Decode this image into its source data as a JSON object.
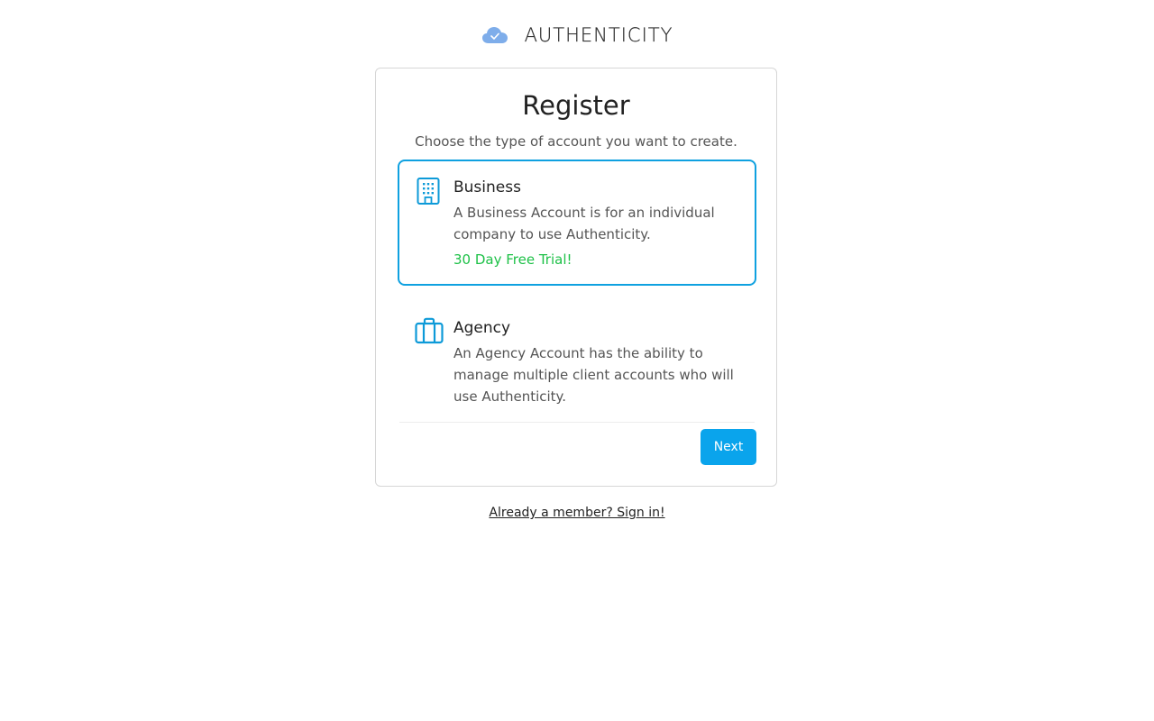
{
  "brand": {
    "name": "AUTHENTICITY",
    "logo_icon": "cloud-check-icon",
    "logo_color": "#7eadea"
  },
  "card": {
    "title": "Register",
    "subtitle": "Choose the type of account you want to create.",
    "options": [
      {
        "title": "Business",
        "description": "A Business Account is for an individual company to use Authenticity.",
        "badge": "30 Day Free Trial!",
        "icon": "building-icon",
        "selected": true
      },
      {
        "title": "Agency",
        "description": "An Agency Account has the ability to manage multiple client accounts who will use Authenticity.",
        "icon": "briefcase-icon",
        "selected": false
      }
    ],
    "next_label": "Next"
  },
  "footer": {
    "signin_link": "Already a member? Sign in!"
  },
  "colors": {
    "accent": "#0aa4ec",
    "selected_border": "#0fa1e0",
    "trial_green": "#1ec148",
    "icon_blue": "#0d9ad8"
  }
}
